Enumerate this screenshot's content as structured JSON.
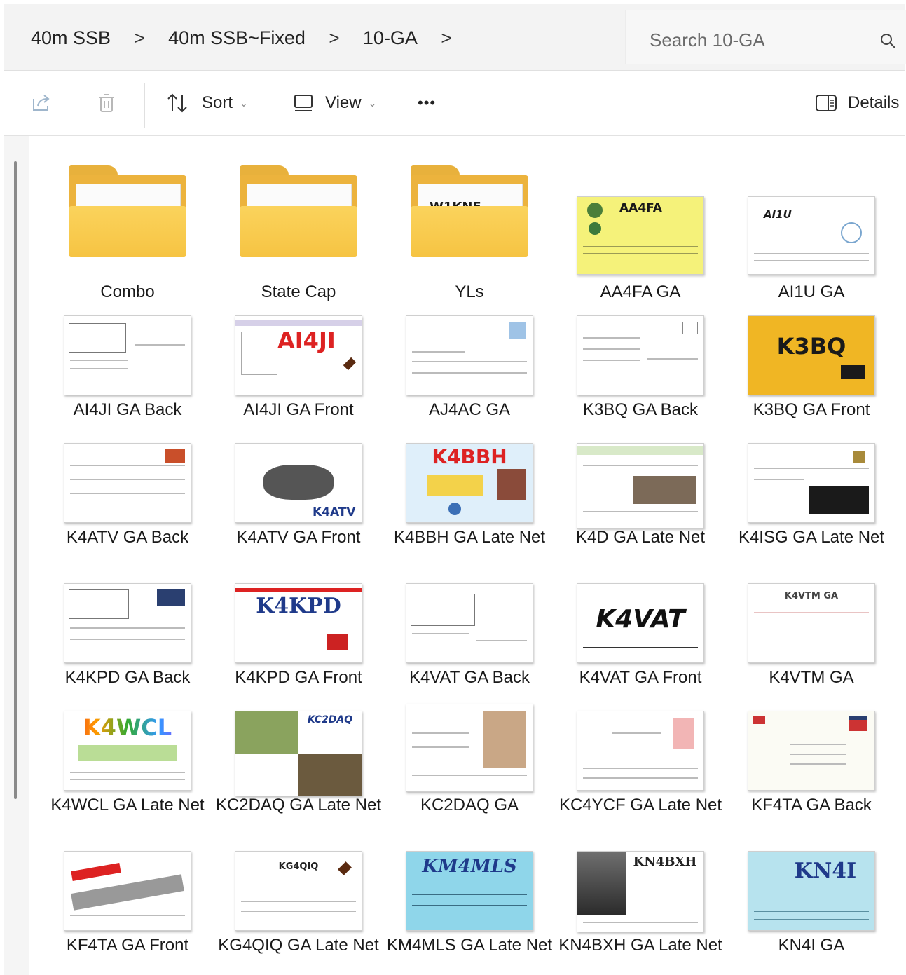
{
  "address_bar": {
    "breadcrumbs": [
      "40m SSB",
      "40m SSB~Fixed",
      "10-GA"
    ],
    "separator": ">",
    "search_placeholder": "Search 10-GA"
  },
  "toolbar": {
    "sort_label": "Sort",
    "view_label": "View",
    "more_label": "•••",
    "details_label": "Details"
  },
  "items": [
    {
      "name": "Combo",
      "kind": "folder"
    },
    {
      "name": "State Cap",
      "kind": "folder"
    },
    {
      "name": "YLs",
      "kind": "folder",
      "preview": "W1KNF"
    },
    {
      "name": "AA4FA GA",
      "kind": "image",
      "preview": "AA4FA"
    },
    {
      "name": "AI1U GA",
      "kind": "image",
      "preview": "AI1U"
    },
    {
      "name": "AI4JI GA Back",
      "kind": "image"
    },
    {
      "name": "AI4JI GA Front",
      "kind": "image",
      "preview": "AI4JI"
    },
    {
      "name": "AJ4AC GA",
      "kind": "image"
    },
    {
      "name": "K3BQ GA Back",
      "kind": "image"
    },
    {
      "name": "K3BQ GA Front",
      "kind": "image",
      "preview": "K3BQ"
    },
    {
      "name": "K4ATV GA Back",
      "kind": "image"
    },
    {
      "name": "K4ATV GA Front",
      "kind": "image",
      "preview": "K4ATV"
    },
    {
      "name": "K4BBH GA Late Net",
      "kind": "image",
      "preview": "K4BBH"
    },
    {
      "name": "K4D GA Late Net",
      "kind": "image"
    },
    {
      "name": "K4ISG GA Late Net",
      "kind": "image"
    },
    {
      "name": "K4KPD GA Back",
      "kind": "image"
    },
    {
      "name": "K4KPD GA Front",
      "kind": "image",
      "preview": "K4KPD"
    },
    {
      "name": "K4VAT GA Back",
      "kind": "image"
    },
    {
      "name": "K4VAT GA Front",
      "kind": "image",
      "preview": "K4VAT"
    },
    {
      "name": "K4VTM GA",
      "kind": "image",
      "preview": "K4VTM GA"
    },
    {
      "name": "K4WCL GA Late Net",
      "kind": "image",
      "preview": "K4WCL"
    },
    {
      "name": "KC2DAQ GA Late Net",
      "kind": "image",
      "preview": "KC2DAQ"
    },
    {
      "name": "KC2DAQ GA",
      "kind": "image"
    },
    {
      "name": "KC4YCF GA Late Net",
      "kind": "image"
    },
    {
      "name": "KF4TA GA Back",
      "kind": "image"
    },
    {
      "name": "KF4TA GA Front",
      "kind": "image"
    },
    {
      "name": "KG4QIQ GA Late Net",
      "kind": "image",
      "preview": "KG4QIQ"
    },
    {
      "name": "KM4MLS GA Late Net",
      "kind": "image",
      "preview": "KM4MLS"
    },
    {
      "name": "KN4BXH GA Late Net",
      "kind": "image",
      "preview": "KN4BXH"
    },
    {
      "name": "KN4I GA",
      "kind": "image",
      "preview": "KN4I"
    }
  ]
}
